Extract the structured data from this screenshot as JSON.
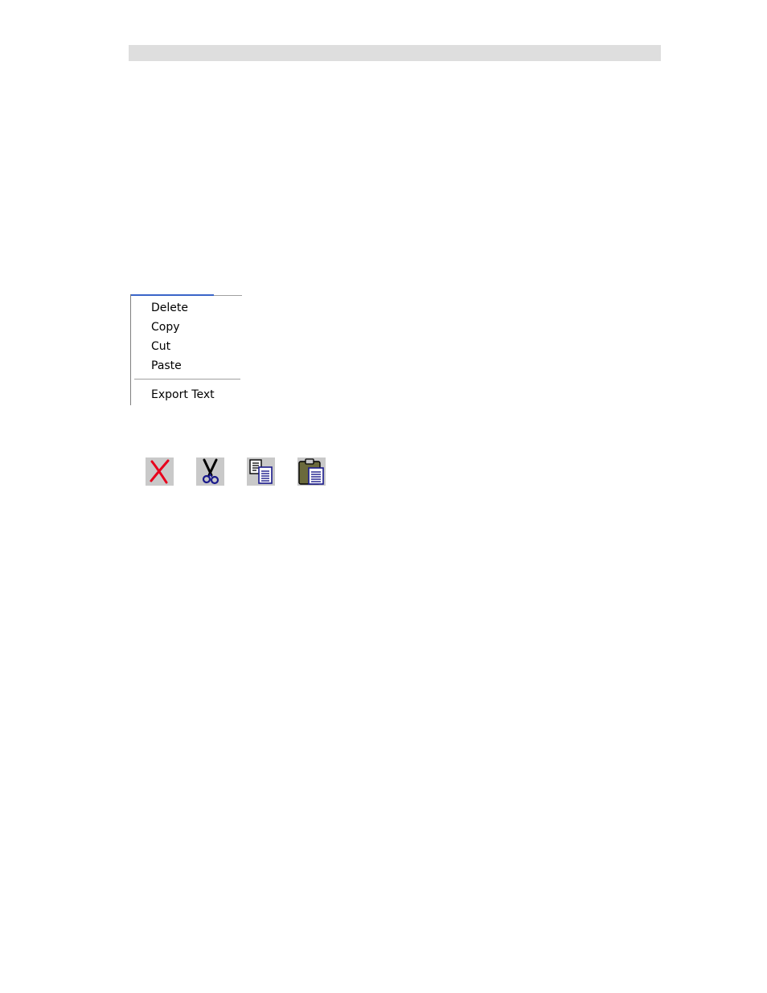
{
  "context_menu": {
    "items": [
      {
        "label": "Delete"
      },
      {
        "label": "Copy"
      },
      {
        "label": "Cut"
      },
      {
        "label": "Paste"
      },
      {
        "label": "Export Text"
      }
    ]
  },
  "toolbar": {
    "buttons": [
      {
        "icon": "delete-icon",
        "color": "#e8001c"
      },
      {
        "icon": "cut-icon",
        "color": "#000000"
      },
      {
        "icon": "copy-icon",
        "color": "#1a1a8c"
      },
      {
        "icon": "paste-icon",
        "color": "#6b6a3c"
      }
    ]
  },
  "colors": {
    "header_bar": "#dedede",
    "menu_accent": "#3a64c8",
    "button_face": "#c9c9c9"
  }
}
